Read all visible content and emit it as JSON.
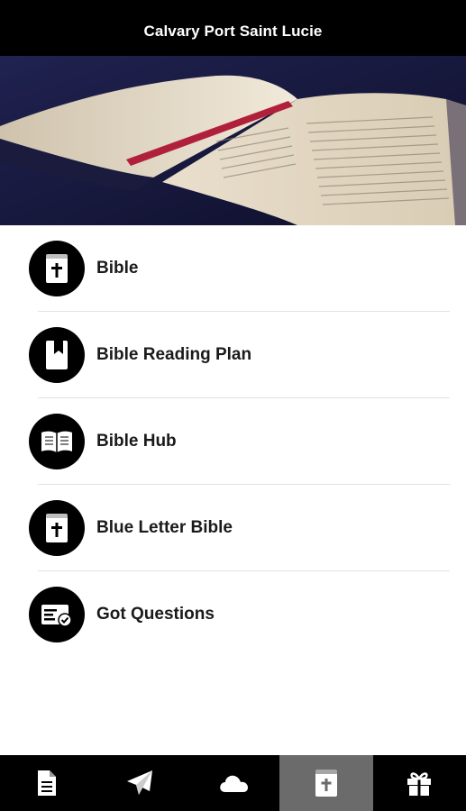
{
  "app": {
    "title": "Calvary Port Saint Lucie"
  },
  "hero": {
    "image": "open-bible-photo"
  },
  "menu": [
    {
      "label": "Bible",
      "icon": "bible-cross-icon"
    },
    {
      "label": "Bible Reading Plan",
      "icon": "bookmark-book-icon"
    },
    {
      "label": "Bible Hub",
      "icon": "open-book-icon"
    },
    {
      "label": "Blue Letter Bible",
      "icon": "bible-cross-icon"
    },
    {
      "label": "Got Questions",
      "icon": "id-card-check-icon"
    }
  ],
  "tabs": [
    {
      "icon": "document-icon",
      "active": false
    },
    {
      "icon": "paper-plane-icon",
      "active": false
    },
    {
      "icon": "cloud-icon",
      "active": false
    },
    {
      "icon": "bible-icon",
      "active": true
    },
    {
      "icon": "gift-icon",
      "active": false
    }
  ],
  "colors": {
    "bar": "#000000",
    "active_tab": "#6b6b6b",
    "divider": "#e3e3e3"
  }
}
